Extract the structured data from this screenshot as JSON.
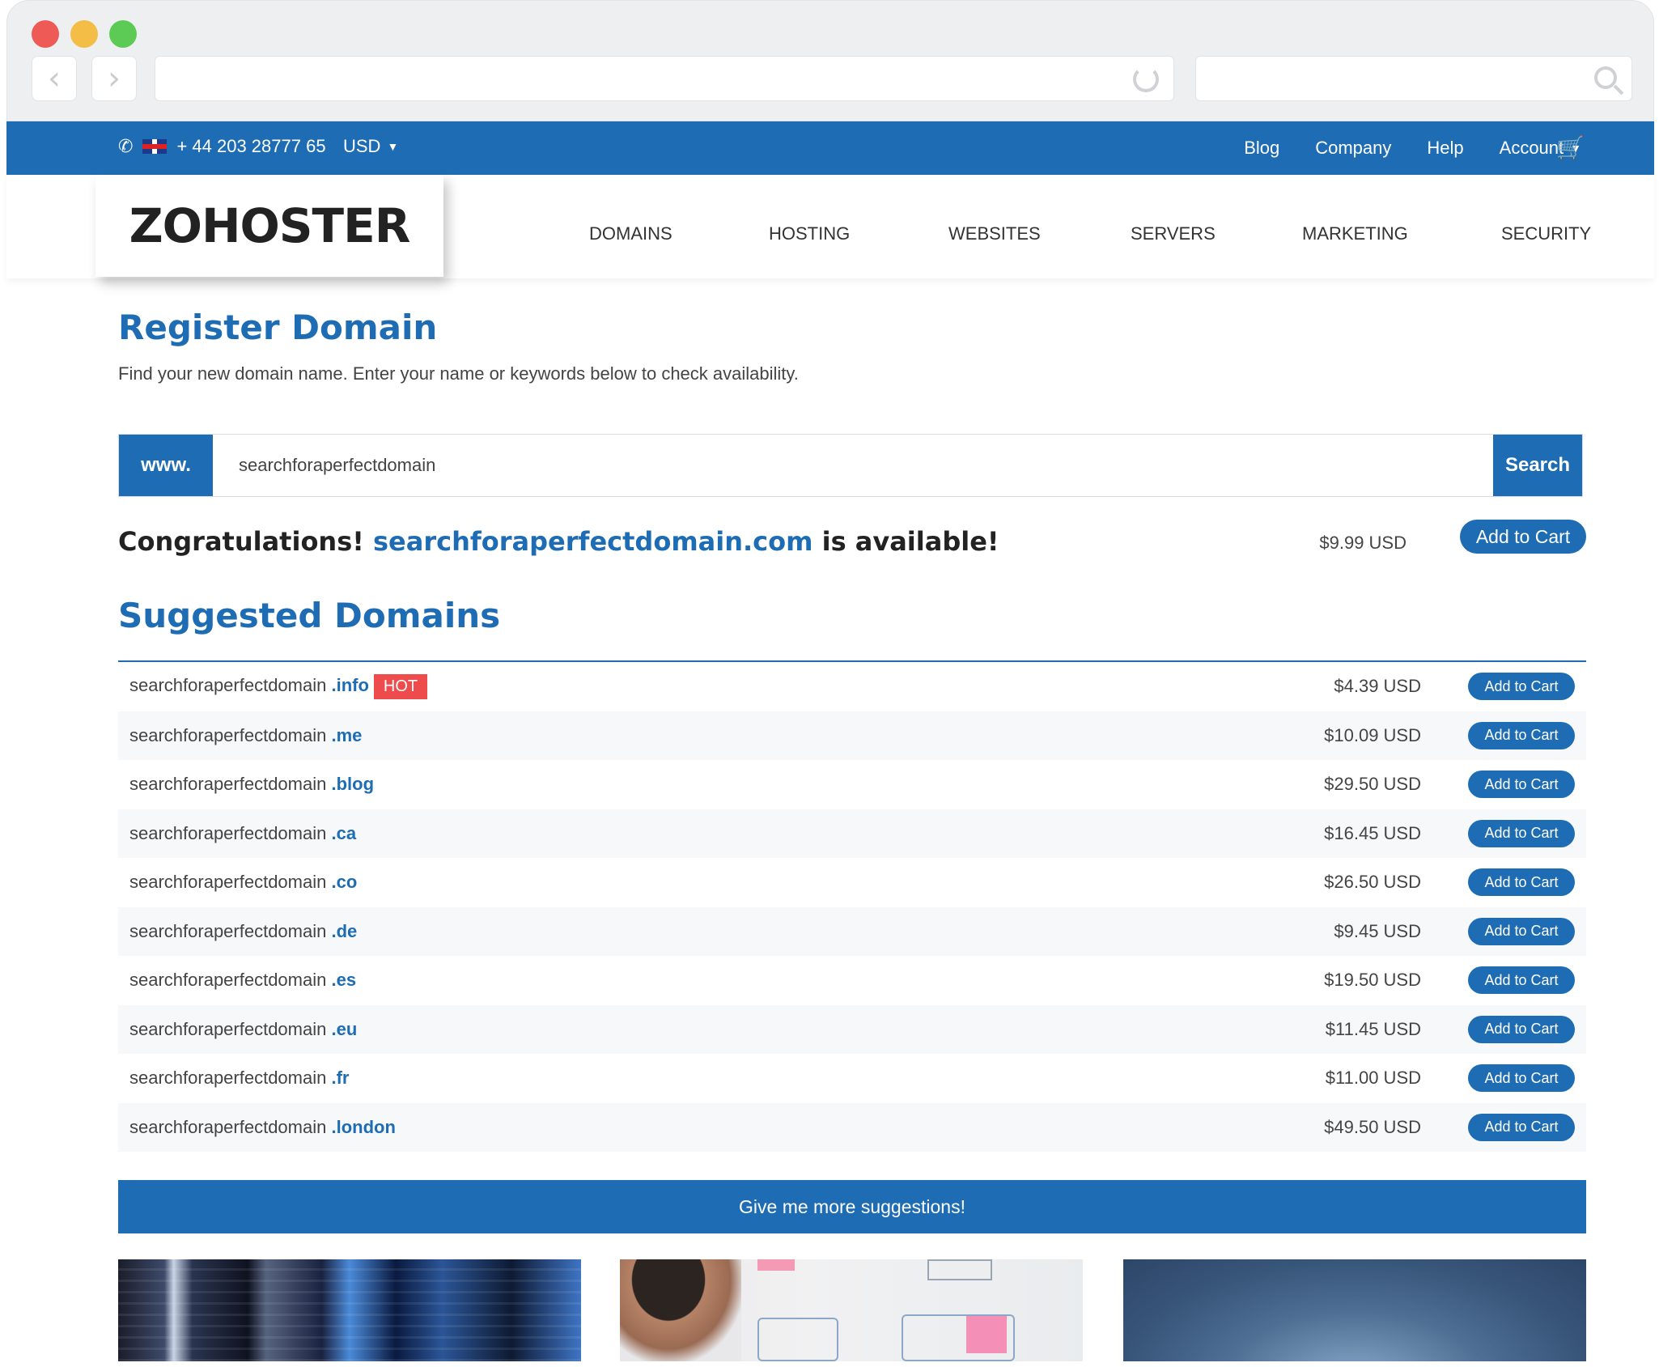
{
  "topbar": {
    "phone": "+ 44 203 28777 65",
    "currency": "USD",
    "links": {
      "blog": "Blog",
      "company": "Company",
      "help": "Help",
      "account": "Account"
    }
  },
  "header": {
    "logo": "ZOHOSTER",
    "nav": [
      "DOMAINS",
      "HOSTING",
      "WEBSITES",
      "SERVERS",
      "MARKETING",
      "SECURITY"
    ]
  },
  "register": {
    "title": "Register Domain",
    "subtitle": "Find your new domain name. Enter your name or keywords below to check availability.",
    "prefix": "www.",
    "input_value": "searchforaperfectdomain",
    "search_label": "Search"
  },
  "availability": {
    "lead": "Congratulations!",
    "domain": "searchforaperfectdomain.com",
    "tail": "is available!",
    "price": "$9.99 USD",
    "cart_label": "Add to Cart"
  },
  "suggested": {
    "title": "Suggested Domains",
    "base": "searchforaperfectdomain",
    "hot_label": "HOT",
    "cart_label": "Add to Cart",
    "rows": [
      {
        "tld": ".info",
        "price": "$4.39 USD",
        "hot": true
      },
      {
        "tld": ".me",
        "price": "$10.09 USD"
      },
      {
        "tld": ".blog",
        "price": "$29.50 USD"
      },
      {
        "tld": ".ca",
        "price": "$16.45 USD"
      },
      {
        "tld": ".co",
        "price": "$26.50 USD"
      },
      {
        "tld": ".de",
        "price": "$9.45 USD"
      },
      {
        "tld": ".es",
        "price": "$19.50 USD"
      },
      {
        "tld": ".eu",
        "price": "$11.45 USD"
      },
      {
        "tld": ".fr",
        "price": "$11.00 USD"
      },
      {
        "tld": ".london",
        "price": "$49.50 USD"
      }
    ],
    "more_label": "Give me more suggestions!"
  },
  "icons": {
    "phone": "phone-icon",
    "flag": "uk-flag-icon",
    "cart": "shopping-cart-icon"
  },
  "colors": {
    "brand_blue": "#1e6db4",
    "hot_red": "#ee4c4c"
  }
}
